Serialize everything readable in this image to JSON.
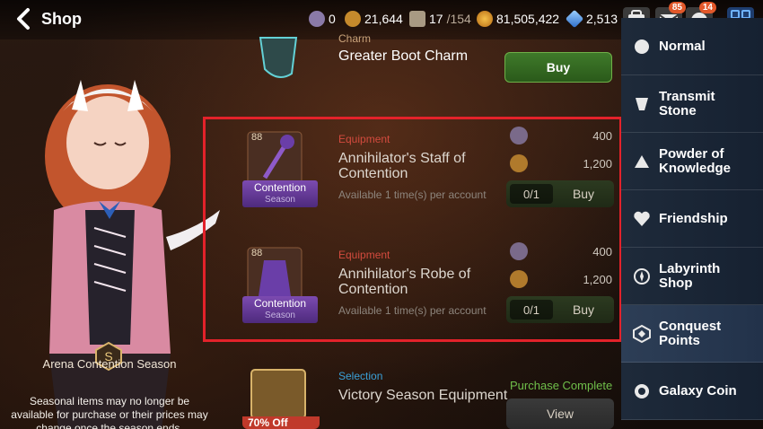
{
  "header": {
    "title": "Shop",
    "resources": [
      {
        "icon": "arena-flag-icon",
        "value": "0",
        "color": "#c9b8e6"
      },
      {
        "icon": "crest-icon",
        "value": "21,644",
        "color": "#e3a33a"
      },
      {
        "icon": "stamina-icon",
        "value": "17",
        "max": "/154",
        "color": "#cfc3ad"
      },
      {
        "icon": "gold-coin-icon",
        "value": "81,505,422",
        "color": "#e8a535"
      },
      {
        "icon": "skystone-icon",
        "value": "2,513",
        "color": "#4fa3e8"
      }
    ],
    "mail_badge": "85",
    "notice_badge": "14"
  },
  "left_panel": {
    "season_label": "Arena Contention Season",
    "season_note": "Seasonal items may no longer be available for purchase or their prices may change once the season ends."
  },
  "items": [
    {
      "category": "Charm",
      "name": "Greater Boot Charm",
      "buy_label": "Buy"
    },
    {
      "category": "Equipment",
      "name": "Annihilator's Staff of Contention",
      "availability": "Available 1 time(s) per account",
      "level": "88",
      "tag_title": "Contention",
      "tag_sub": "Season",
      "price1": "400",
      "price2": "1,200",
      "limit": "0/1",
      "buy_label": "Buy"
    },
    {
      "category": "Equipment",
      "name": "Annihilator's Robe of Contention",
      "availability": "Available 1 time(s) per account",
      "level": "88",
      "tag_title": "Contention",
      "tag_sub": "Season",
      "price1": "400",
      "price2": "1,200",
      "limit": "0/1",
      "buy_label": "Buy"
    },
    {
      "category": "Selection",
      "name": "Victory Season Equipment",
      "status": "Purchase Complete",
      "discount": "70% Off",
      "view_label": "View"
    }
  ],
  "sidebar": {
    "items": [
      {
        "label": "Normal",
        "icon": "normal-shop-icon"
      },
      {
        "label": "Transmit Stone",
        "icon": "transmit-stone-icon"
      },
      {
        "label": "Powder of Knowledge",
        "icon": "powder-icon"
      },
      {
        "label": "Friendship",
        "icon": "heart-icon"
      },
      {
        "label": "Labyrinth Shop",
        "icon": "compass-icon"
      },
      {
        "label": "Conquest Points",
        "icon": "conquest-icon",
        "active": true
      },
      {
        "label": "Galaxy Coin",
        "icon": "galaxy-coin-icon"
      }
    ]
  }
}
